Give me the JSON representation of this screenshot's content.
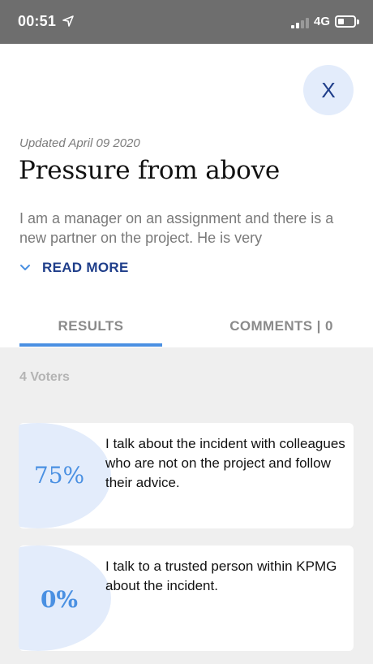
{
  "status_bar": {
    "time": "00:51",
    "network": "4G"
  },
  "close_label": "X",
  "post": {
    "updated": "Updated April 09 2020",
    "title": "Pressure from above",
    "excerpt": "I am a manager on an assignment and there is a new partner on the project. He is very",
    "read_more": "READ MORE"
  },
  "tabs": [
    {
      "label": "RESULTS",
      "active": true
    },
    {
      "label": "COMMENTS | 0",
      "active": false
    }
  ],
  "results": {
    "voters": "4 Voters",
    "options": [
      {
        "percent": "75%",
        "text": "I talk about the incident with colleagues who are not on the project and follow their advice."
      },
      {
        "percent": "0%",
        "text": "I talk to a trusted person within KPMG about the incident."
      }
    ]
  },
  "colors": {
    "accent": "#4a90e2",
    "brand_dark": "#1f3e8a",
    "bubble": "#e3ecfb"
  }
}
